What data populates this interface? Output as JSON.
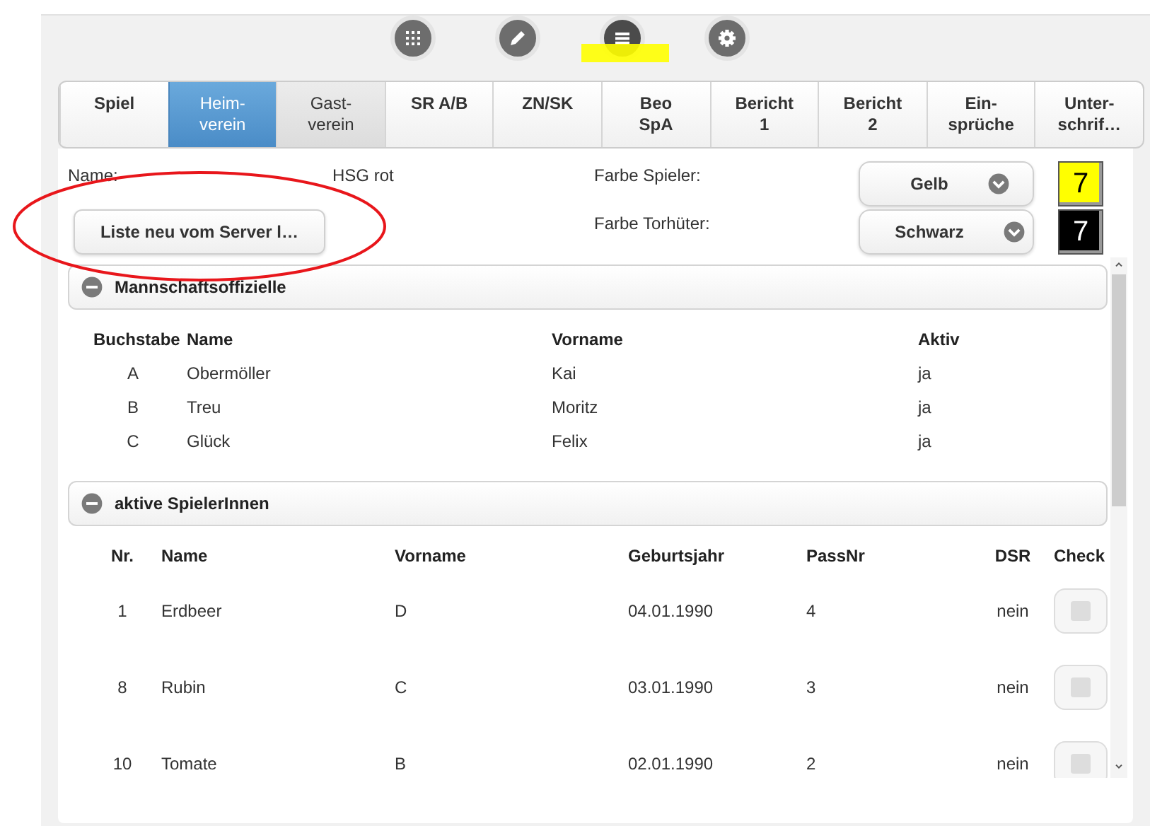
{
  "toolbar": {
    "icons": [
      {
        "kind": "grid",
        "selected": false
      },
      {
        "kind": "pencil",
        "selected": false
      },
      {
        "kind": "list",
        "selected": true
      },
      {
        "kind": "gear",
        "selected": false
      }
    ]
  },
  "tabs": [
    {
      "label": "Spiel",
      "selected": false,
      "highlighted": false
    },
    {
      "label": "Heim-\nverein",
      "selected": true,
      "highlighted": false
    },
    {
      "label": "Gast-\nverein",
      "selected": false,
      "highlighted": true
    },
    {
      "label": "SR A/B",
      "selected": false,
      "highlighted": false
    },
    {
      "label": "ZN/SK",
      "selected": false,
      "highlighted": false
    },
    {
      "label": "Beo\nSpA",
      "selected": false,
      "highlighted": false
    },
    {
      "label": "Bericht\n1",
      "selected": false,
      "highlighted": false
    },
    {
      "label": "Bericht\n2",
      "selected": false,
      "highlighted": false
    },
    {
      "label": "Ein-\nsprüche",
      "selected": false,
      "highlighted": false
    },
    {
      "label": "Unter-\nschrif…",
      "selected": false,
      "highlighted": false
    }
  ],
  "team": {
    "name_label": "Name:",
    "name_value": "HSG rot",
    "reload_button": "Liste neu vom Server l…",
    "colors": [
      {
        "label": "Farbe Spieler:",
        "value": "Gelb",
        "number": "7",
        "color": "#ffff00"
      },
      {
        "label": "Farbe Torhüter:",
        "value": "Schwarz",
        "number": "7",
        "color": "#000000"
      }
    ]
  },
  "officials": {
    "title": "Mannschaftsoffizielle",
    "expanded": true,
    "columns": [
      "Buchstabe",
      "Name",
      "Vorname",
      "Aktiv"
    ],
    "rows": [
      [
        "A",
        "Obermöller",
        "Kai",
        "ja"
      ],
      [
        "B",
        "Treu",
        "Moritz",
        "ja"
      ],
      [
        "C",
        "Glück",
        "Felix",
        "ja"
      ]
    ]
  },
  "players": {
    "title": "aktive SpielerInnen",
    "expanded": true,
    "columns": [
      "Nr.",
      "Name",
      "Vorname",
      "Geburtsjahr",
      "PassNr",
      "DSR",
      "Check"
    ],
    "rows": [
      {
        "cells": [
          "1",
          "Erdbeer",
          "D",
          "04.01.1990",
          "4",
          "nein"
        ],
        "checked": false
      },
      {
        "cells": [
          "8",
          "Rubin",
          "C",
          "03.01.1990",
          "3",
          "nein"
        ],
        "checked": false
      },
      {
        "cells": [
          "10",
          "Tomate",
          "B",
          "02.01.1990",
          "2",
          "nein"
        ],
        "checked": false
      }
    ]
  }
}
